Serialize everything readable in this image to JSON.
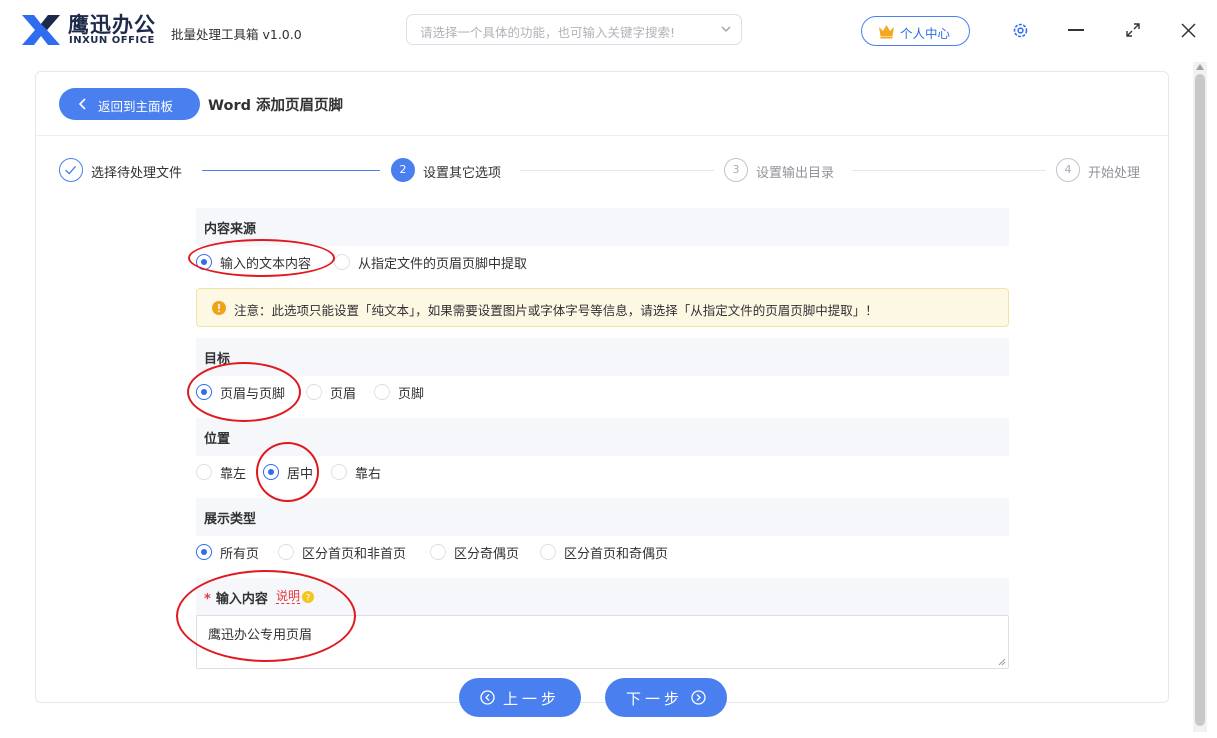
{
  "app": {
    "brand_cn": "鹰迅办公",
    "brand_en": "INXUN OFFICE",
    "title": "批量处理工具箱 v1.0.0",
    "search_placeholder": "请选择一个具体的功能，也可输入关键字搜索!",
    "user_center": "个人中心"
  },
  "header": {
    "back_label": "返回到主面板",
    "page_title": "Word 添加页眉页脚"
  },
  "steps": [
    {
      "num": "✓",
      "label": "选择待处理文件",
      "state": "done"
    },
    {
      "num": "2",
      "label": "设置其它选项",
      "state": "active"
    },
    {
      "num": "3",
      "label": "设置输出目录",
      "state": "pending"
    },
    {
      "num": "4",
      "label": "开始处理",
      "state": "pending"
    }
  ],
  "source": {
    "title": "内容来源",
    "options": [
      "输入的文本内容",
      "从指定文件的页眉页脚中提取"
    ],
    "selected": 0
  },
  "notice": "注意：此选项只能设置「纯文本」，如果需要设置图片或字体字号等信息，请选择「从指定文件的页眉页脚中提取」！",
  "target": {
    "title": "目标",
    "options": [
      "页眉与页脚",
      "页眉",
      "页脚"
    ],
    "selected": 0
  },
  "position": {
    "title": "位置",
    "options": [
      "靠左",
      "居中",
      "靠右"
    ],
    "selected": 1
  },
  "display": {
    "title": "展示类型",
    "options": [
      "所有页",
      "区分首页和非首页",
      "区分奇偶页",
      "区分首页和奇偶页"
    ],
    "selected": 0
  },
  "input": {
    "required_mark": "*",
    "title": "输入内容",
    "help": "说明",
    "value": "鹰迅办公专用页眉"
  },
  "nav": {
    "prev": "上一步",
    "next": "下一步"
  },
  "colors": {
    "primary": "#4a7ff0",
    "annotation": "#e0191f",
    "warning": "#f0a31a"
  }
}
